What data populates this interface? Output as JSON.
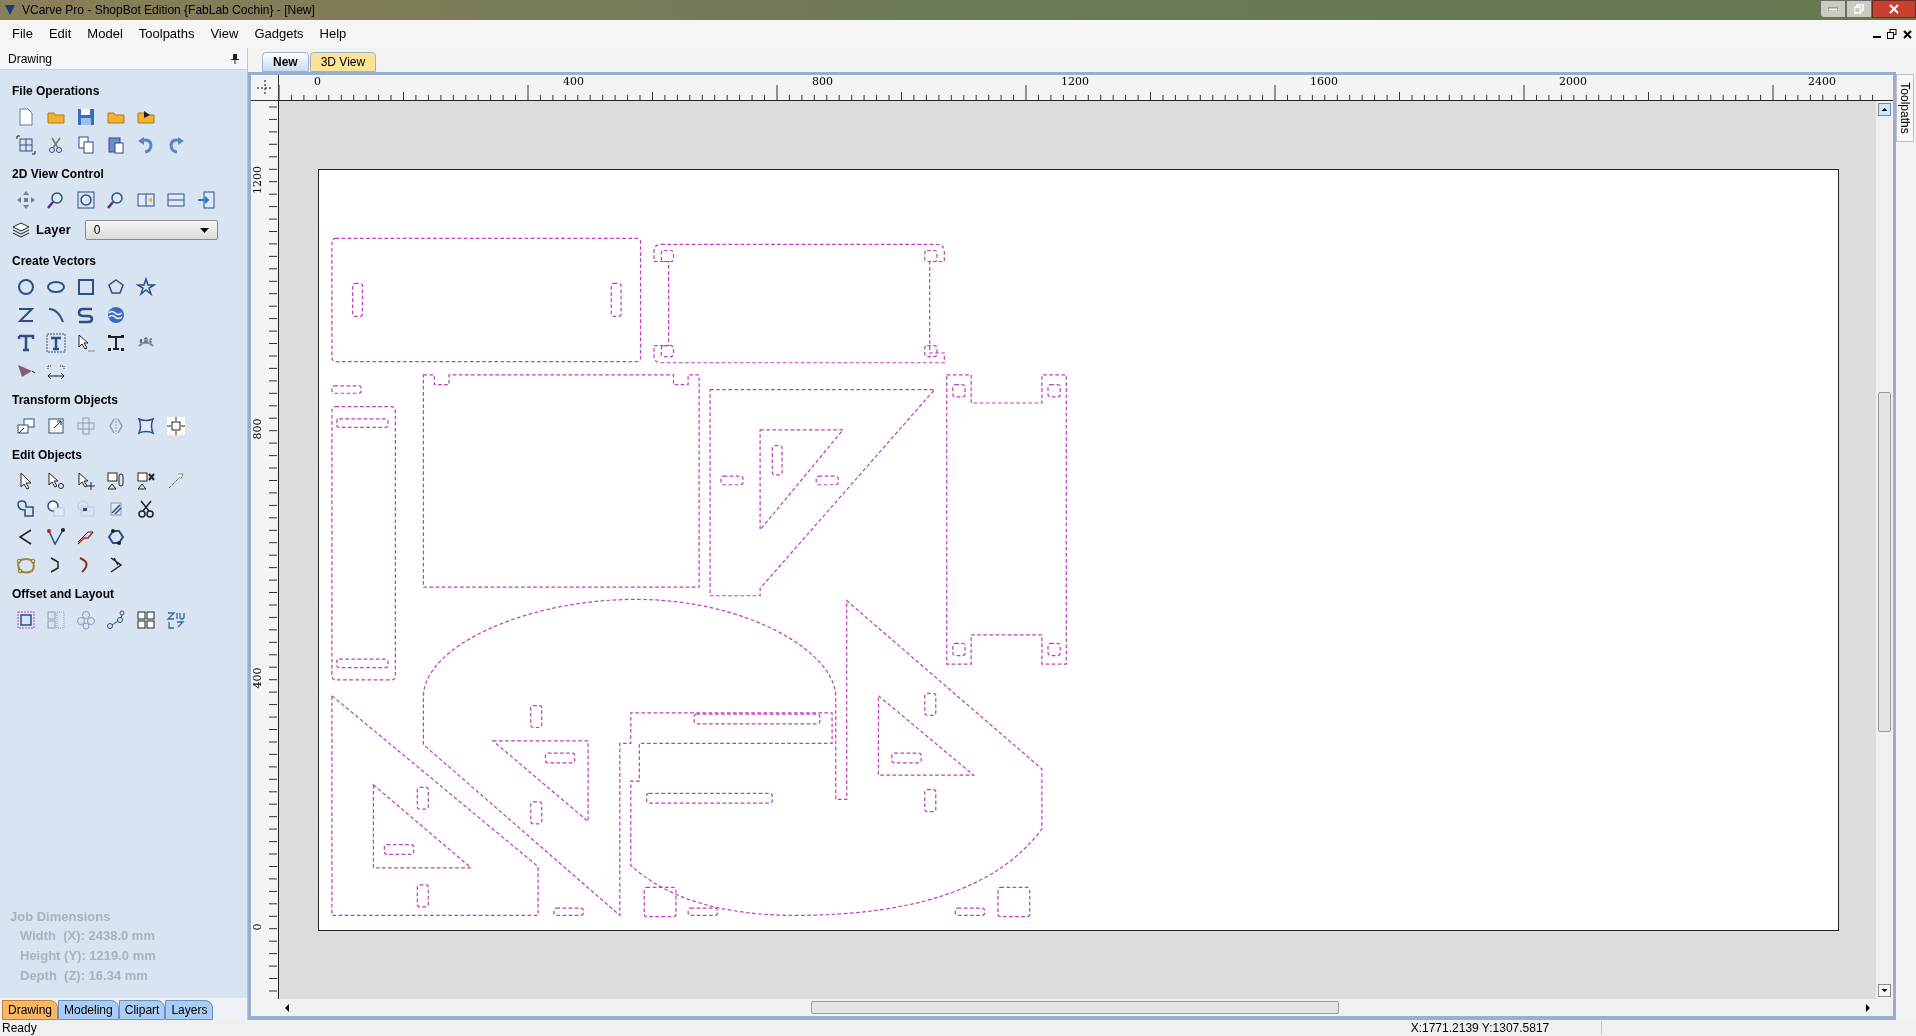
{
  "window": {
    "title": "VCarve Pro - ShopBot Edition {FabLab Cochin} - [New]"
  },
  "menu": [
    "File",
    "Edit",
    "Model",
    "Toolpaths",
    "View",
    "Gadgets",
    "Help"
  ],
  "panel": {
    "title": "Drawing",
    "sections": [
      {
        "kind": "tools",
        "title": "File Operations"
      },
      {
        "kind": "tools",
        "title": "2D View Control"
      },
      {
        "kind": "layer",
        "label": "Layer",
        "value": "0"
      },
      {
        "kind": "tools",
        "title": "Create Vectors"
      },
      {
        "kind": "tools",
        "title": "Transform Objects"
      },
      {
        "kind": "tools",
        "title": "Edit Objects"
      },
      {
        "kind": "tools",
        "title": "Offset and Layout"
      }
    ],
    "job_dimensions": {
      "title": "Job Dimensions",
      "lines": [
        "Width  (X): 2438.0 mm",
        "Height (Y): 1219.0 mm",
        "Depth  (Z): 16.34 mm"
      ]
    },
    "tabs": [
      {
        "label": "Drawing",
        "selected": true
      },
      {
        "label": "Modeling",
        "selected": false
      },
      {
        "label": "Clipart",
        "selected": false
      },
      {
        "label": "Layers",
        "selected": false
      }
    ]
  },
  "document_tabs": [
    {
      "label": "New",
      "selected": true
    },
    {
      "label": "3D View",
      "selected": false
    }
  ],
  "ruler": {
    "x_labels": [
      "0",
      "400",
      "800",
      "1200",
      "1600",
      "2000",
      "2400"
    ],
    "y_labels": [
      "1200",
      "800",
      "400",
      "0"
    ]
  },
  "side_tab": "Toolpaths",
  "status_bar": {
    "message": "Ready",
    "coordinates": "X:1771.2139 Y:1307.5817"
  }
}
